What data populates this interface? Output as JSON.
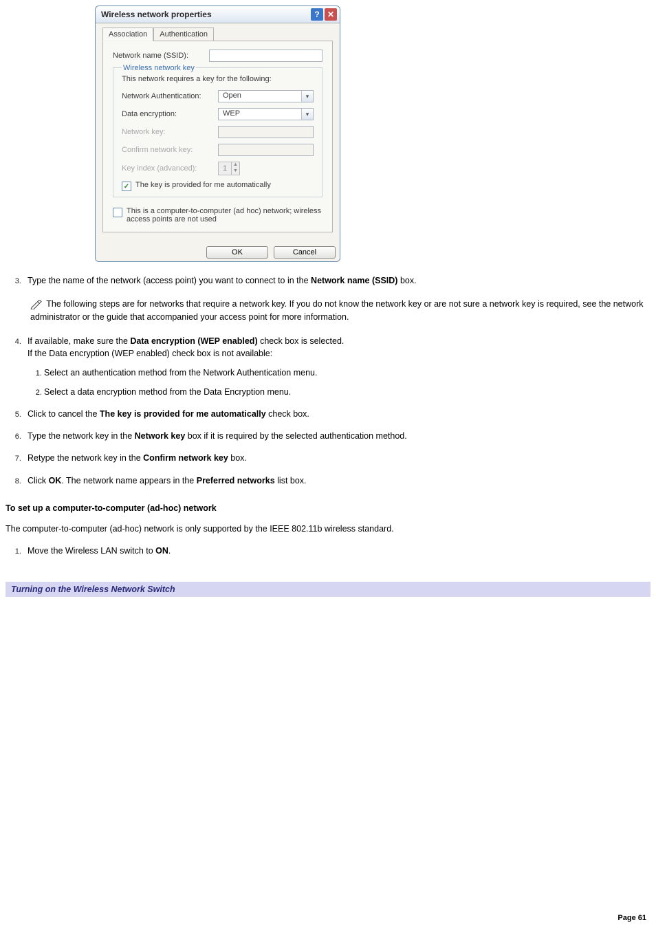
{
  "dialog": {
    "title": "Wireless network properties",
    "tabs": {
      "association": "Association",
      "authentication": "Authentication"
    },
    "ssid_label": "Network name (SSID):",
    "ssid_value": "",
    "group_title": "Wireless network key",
    "group_desc": "This network requires a key for the following:",
    "auth_label": "Network Authentication:",
    "auth_value": "Open",
    "enc_label": "Data encryption:",
    "enc_value": "WEP",
    "netkey_label": "Network key:",
    "confirm_label": "Confirm network key:",
    "keyindex_label": "Key index (advanced):",
    "keyindex_value": "1",
    "autokey_label": "The key is provided for me automatically",
    "adhoc_label": "This is a computer-to-computer (ad hoc) network; wireless access points are not used",
    "ok": "OK",
    "cancel": "Cancel"
  },
  "doc": {
    "step3_a": "Type the name of the network (access point) you want to connect to in the ",
    "step3_bold": "Network name (SSID)",
    "step3_b": " box.",
    "note": " The following steps are for networks that require a network key. If you do not know the network key or are not sure a network key is required, see the network administrator or the guide that accompanied your access point for more information.",
    "step4_a": "If available, make sure the ",
    "step4_bold": "Data encryption (WEP enabled)",
    "step4_b": " check box is selected.",
    "step4_line2": "If the Data encryption (WEP enabled) check box is not available:",
    "step4_sub1": "Select an authentication method from the Network Authentication menu.",
    "step4_sub2": "Select a data encryption method from the Data Encryption menu.",
    "step5_a": "Click to cancel the ",
    "step5_bold": "The key is provided for me automatically",
    "step5_b": " check box.",
    "step6_a": "Type the network key in the ",
    "step6_bold": "Network key",
    "step6_b": " box if it is required by the selected authentication method.",
    "step7_a": "Retype the network key in the ",
    "step7_bold": "Confirm network key",
    "step7_b": " box.",
    "step8_a": "Click ",
    "step8_bold1": "OK",
    "step8_b": ". The network name appears in the ",
    "step8_bold2": "Preferred networks",
    "step8_c": " list box.",
    "section_head": "To set up a computer-to-computer (ad-hoc) network",
    "para": "The computer-to-computer (ad-hoc) network is only supported by the IEEE 802.11b wireless standard.",
    "adhoc_step1_a": "Move the Wireless LAN switch to ",
    "adhoc_step1_bold": "ON",
    "adhoc_step1_b": ".",
    "caption": "Turning on the Wireless Network Switch",
    "page": "Page 61"
  }
}
